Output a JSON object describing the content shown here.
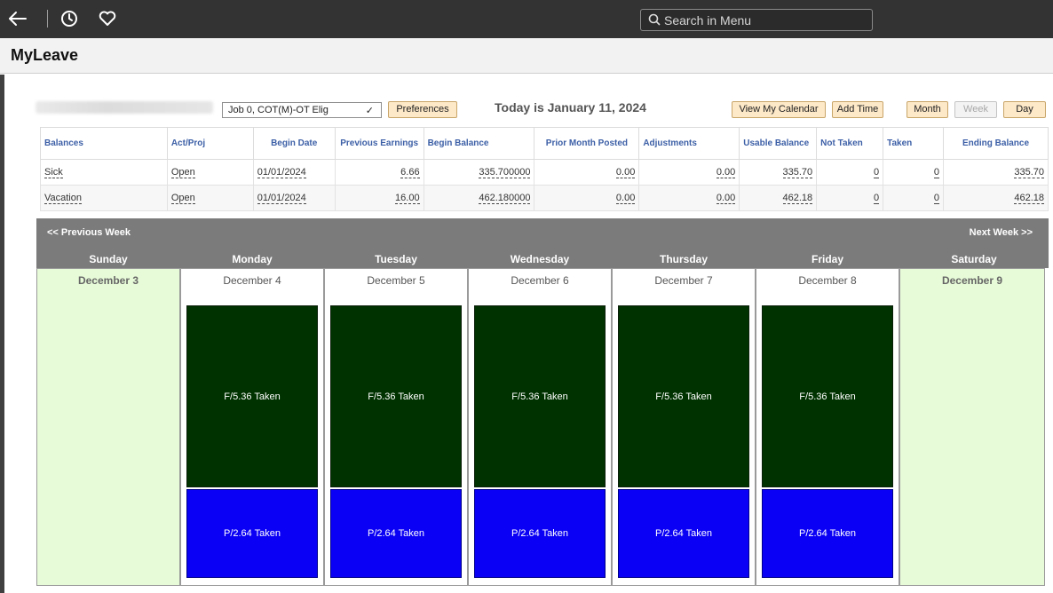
{
  "header": {
    "search_placeholder": "Search in Menu"
  },
  "page": {
    "title": "MyLeave"
  },
  "toolbar": {
    "job_select": "Job 0, COT(M)-OT Elig",
    "preferences": "Preferences",
    "today": "Today is January 11, 2024",
    "view_calendar": "View My Calendar",
    "add_time": "Add Time",
    "month": "Month",
    "week": "Week",
    "day": "Day"
  },
  "balances": {
    "headers": [
      "Balances",
      "Act/Proj",
      "Begin Date",
      "Previous Earnings",
      "Begin Balance",
      "Prior Month Posted",
      "Adjustments",
      "Usable Balance",
      "Not Taken",
      "Taken",
      "Ending Balance"
    ],
    "rows": [
      [
        "Sick",
        "Open",
        "01/01/2024",
        "6.66",
        "335.700000",
        "0.00",
        "0.00",
        "335.70",
        "0",
        "0",
        "335.70"
      ],
      [
        "Vacation",
        "Open",
        "01/01/2024",
        "16.00",
        "462.180000",
        "0.00",
        "0.00",
        "462.18",
        "0",
        "0",
        "462.18"
      ]
    ]
  },
  "calendar": {
    "prev_week": "<< Previous Week",
    "next_week": "Next Week >>",
    "days": [
      {
        "name": "Sunday",
        "date": "December 3",
        "weekend": true,
        "blocks": []
      },
      {
        "name": "Monday",
        "date": "December 4",
        "weekend": false,
        "blocks": [
          "F/5.36 Taken",
          "P/2.64 Taken"
        ]
      },
      {
        "name": "Tuesday",
        "date": "December 5",
        "weekend": false,
        "blocks": [
          "F/5.36 Taken",
          "P/2.64 Taken"
        ]
      },
      {
        "name": "Wednesday",
        "date": "December 6",
        "weekend": false,
        "blocks": [
          "F/5.36 Taken",
          "P/2.64 Taken"
        ]
      },
      {
        "name": "Thursday",
        "date": "December 7",
        "weekend": false,
        "blocks": [
          "F/5.36 Taken",
          "P/2.64 Taken"
        ]
      },
      {
        "name": "Friday",
        "date": "December 8",
        "weekend": false,
        "blocks": [
          "F/5.36 Taken",
          "P/2.64 Taken"
        ]
      },
      {
        "name": "Saturday",
        "date": "December 9",
        "weekend": true,
        "blocks": []
      }
    ]
  },
  "colors": {
    "topbar": "#333333",
    "full_day_block": "#003200",
    "partial_block": "#0a00f5",
    "weekend_bg": "#e7fbd8",
    "button_bg": "#fde8c7"
  },
  "icons": [
    "back-arrow-icon",
    "history-clock-icon",
    "favorites-heart-icon",
    "search-icon",
    "dropdown-chevron-icon"
  ]
}
